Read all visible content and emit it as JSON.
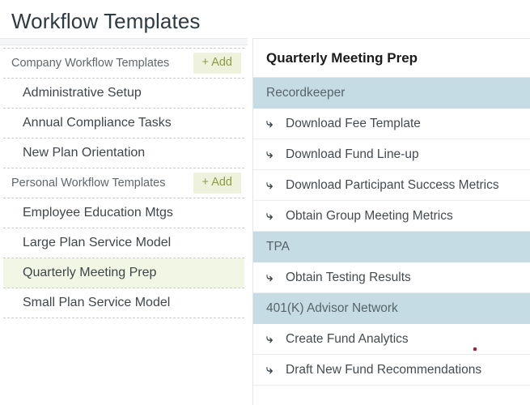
{
  "page": {
    "title": "Workflow Templates"
  },
  "sidebar": {
    "groups": [
      {
        "label": "Company Workflow Templates",
        "add_label": "+ Add",
        "items": [
          {
            "label": "Administrative Setup",
            "selected": false
          },
          {
            "label": "Annual Compliance Tasks",
            "selected": false
          },
          {
            "label": "New Plan Orientation",
            "selected": false
          }
        ]
      },
      {
        "label": "Personal Workflow Templates",
        "add_label": "+ Add",
        "items": [
          {
            "label": "Employee Education Mtgs",
            "selected": false
          },
          {
            "label": "Large Plan Service Model",
            "selected": false
          },
          {
            "label": "Quarterly Meeting Prep",
            "selected": true
          },
          {
            "label": "Small Plan Service Model",
            "selected": false
          }
        ]
      }
    ]
  },
  "detail": {
    "title": "Quarterly Meeting Prep",
    "arrow_icon": "⤷",
    "sections": [
      {
        "name": "Recordkeeper",
        "tasks": [
          "Download Fee Template",
          "Download Fund Line-up",
          "Download Participant Success Metrics",
          "Obtain Group Meeting Metrics"
        ]
      },
      {
        "name": "TPA",
        "tasks": [
          "Obtain Testing Results"
        ]
      },
      {
        "name": "401(K) Advisor Network",
        "tasks": [
          "Create Fund Analytics",
          "Draft New Fund Recommendations"
        ]
      }
    ]
  },
  "colors": {
    "section_header_bg": "#c5dce4",
    "section_header_text": "#59646a",
    "add_button_bg": "#eef2dc",
    "add_button_text": "#8d9c3f",
    "selected_row_bg": "#f2f6e4",
    "page_title_text": "#2e3b45",
    "cursor_marker": "#b5192d"
  }
}
